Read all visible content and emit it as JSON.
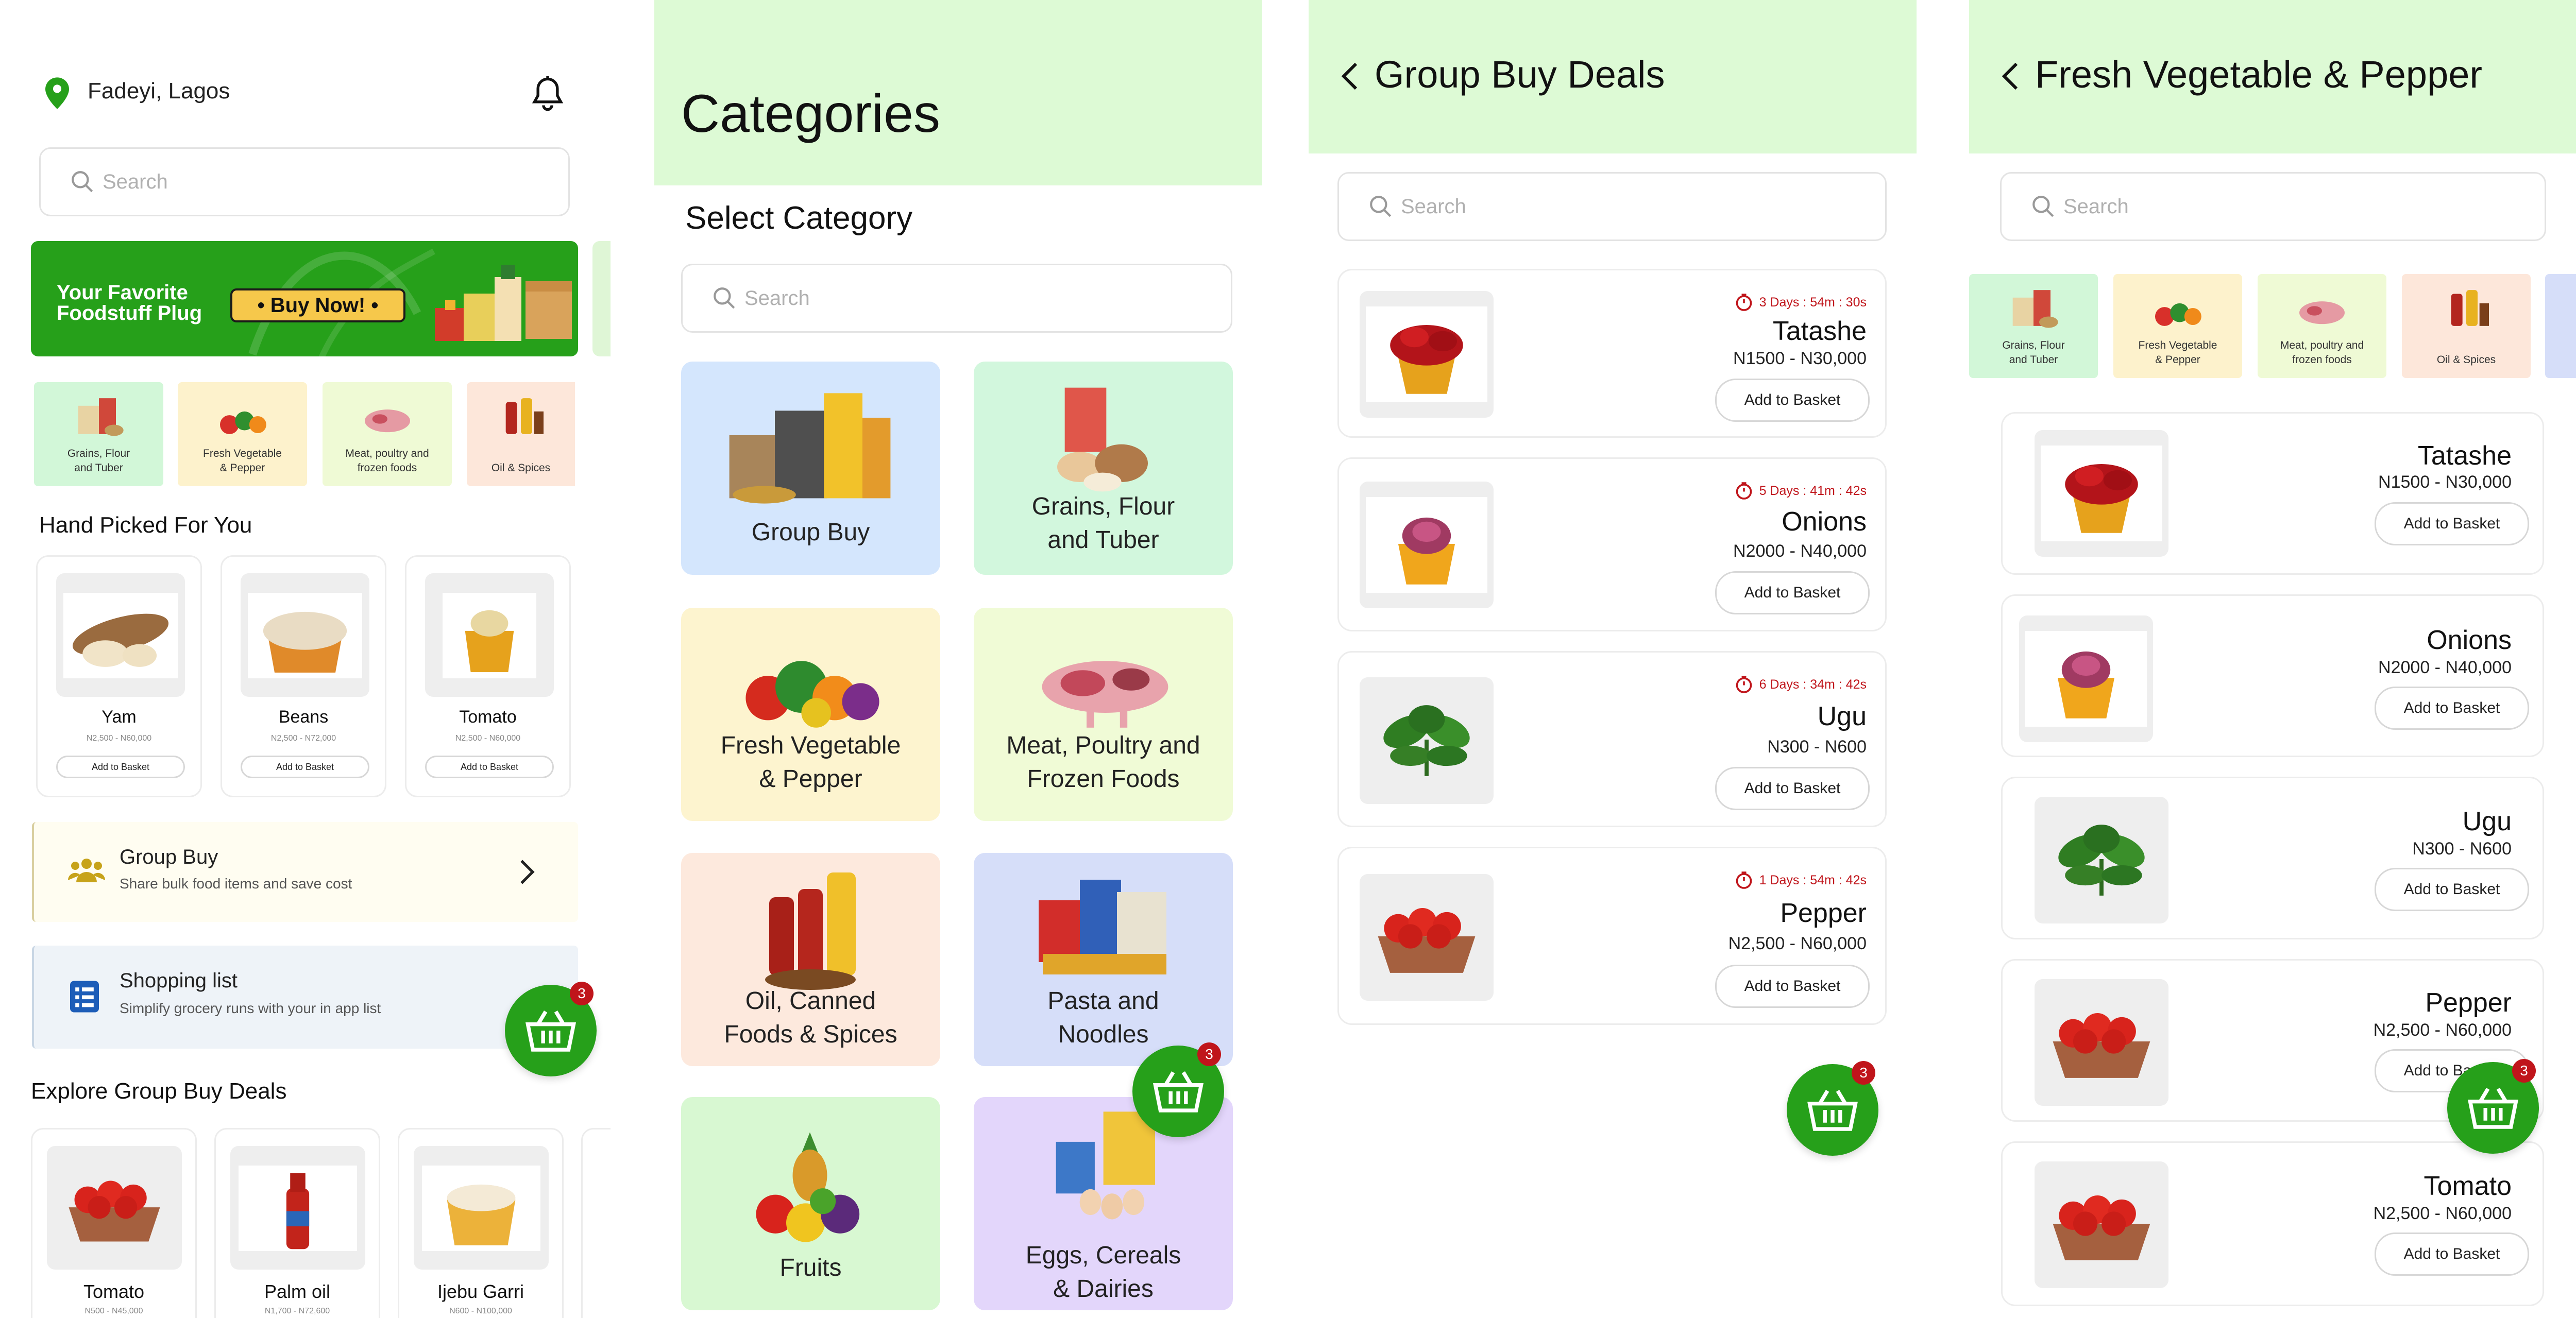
{
  "colors": {
    "green": "#26a01a",
    "light_green": "#ddfad5",
    "red": "#c0151b"
  },
  "home": {
    "location": "Fadeyi, Lagos",
    "search_placeholder": "Search",
    "banner": {
      "line1": "Your Favorite",
      "line2": "Foodstuff Plug",
      "cta": "• Buy Now! •"
    },
    "chips": [
      {
        "label1": "Grains, Flour",
        "label2": "and Tuber"
      },
      {
        "label1": "Fresh Vegetable",
        "label2": "& Pepper"
      },
      {
        "label1": "Meat, poultry and",
        "label2": "frozen foods"
      },
      {
        "label1": "Oil & Spices",
        "label2": ""
      }
    ],
    "hand_picked_title": "Hand Picked For You",
    "hand_picked": [
      {
        "name": "Yam",
        "price": "N2,500 - N60,000",
        "btn": "Add to Basket"
      },
      {
        "name": "Beans",
        "price": "N2,500 - N72,000",
        "btn": "Add to Basket"
      },
      {
        "name": "Tomato",
        "price": "N2,500 - N60,000",
        "btn": "Add to Basket"
      }
    ],
    "group_buy": {
      "title": "Group Buy",
      "subtitle": "Share bulk food items and save cost"
    },
    "shopping_list": {
      "title": "Shopping list",
      "subtitle": "Simplify grocery runs with your in app list"
    },
    "explore_title": "Explore Group Buy Deals",
    "explore": [
      {
        "name": "Tomato",
        "price": "N500 - N45,000"
      },
      {
        "name": "Palm oil",
        "price": "N1,700 - N72,600"
      },
      {
        "name": "Ijebu Garri",
        "price": "N600 - N100,000"
      }
    ],
    "basket_count": "3"
  },
  "categories": {
    "title": "Categories",
    "subtitle": "Select Category",
    "search_placeholder": "Search",
    "tiles": [
      {
        "l1": "Group Buy",
        "l2": ""
      },
      {
        "l1": "Grains, Flour",
        "l2": "and Tuber"
      },
      {
        "l1": "Fresh Vegetable",
        "l2": "& Pepper"
      },
      {
        "l1": "Meat, Poultry and",
        "l2": "Frozen Foods"
      },
      {
        "l1": "Oil, Canned",
        "l2": "Foods & Spices"
      },
      {
        "l1": "Pasta and",
        "l2": "Noodles"
      },
      {
        "l1": "Fruits",
        "l2": ""
      },
      {
        "l1": "Eggs, Cereals",
        "l2": "& Dairies"
      }
    ],
    "basket_count": "3"
  },
  "deals": {
    "title": "Group Buy Deals",
    "search_placeholder": "Search",
    "items": [
      {
        "timer": "3 Days : 54m : 30s",
        "name": "Tatashe",
        "price": "N1500 - N30,000",
        "btn": "Add to Basket"
      },
      {
        "timer": "5 Days : 41m : 42s",
        "name": "Onions",
        "price": "N2000 - N40,000",
        "btn": "Add to Basket"
      },
      {
        "timer": "6 Days : 34m : 42s",
        "name": "Ugu",
        "price": "N300 - N600",
        "btn": "Add to Basket"
      },
      {
        "timer": "1 Days : 54m : 42s",
        "name": "Pepper",
        "price": "N2,500 - N60,000",
        "btn": "Add to Basket"
      }
    ],
    "basket_count": "3"
  },
  "vegetable": {
    "title": "Fresh Vegetable & Pepper",
    "search_placeholder": "Search",
    "chips": [
      {
        "label1": "Grains, Flour",
        "label2": "and Tuber"
      },
      {
        "label1": "Fresh Vegetable",
        "label2": "& Pepper"
      },
      {
        "label1": "Meat, poultry and",
        "label2": "frozen foods"
      },
      {
        "label1": "Oil & Spices",
        "label2": ""
      }
    ],
    "items": [
      {
        "name": "Tatashe",
        "price": "N1500 - N30,000",
        "btn": "Add to Basket"
      },
      {
        "name": "Onions",
        "price": "N2000 - N40,000",
        "btn": "Add to Basket"
      },
      {
        "name": "Ugu",
        "price": "N300 - N600",
        "btn": "Add to Basket"
      },
      {
        "name": "Pepper",
        "price": "N2,500 - N60,000",
        "btn": "Add to Basket"
      },
      {
        "name": "Tomato",
        "price": "N2,500 - N60,000",
        "btn": "Add to Basket"
      }
    ],
    "basket_count": "3"
  }
}
